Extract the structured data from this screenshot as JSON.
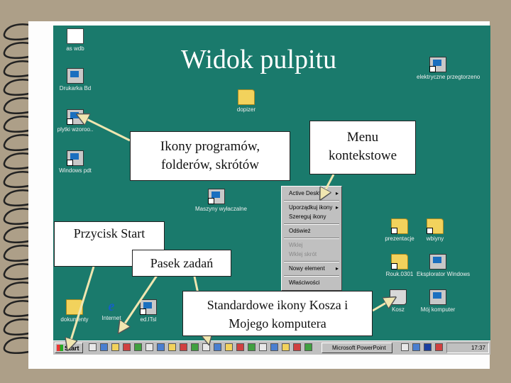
{
  "slide": {
    "title": "Widok pulpitu",
    "callouts": {
      "icons": [
        "Ikony programów,",
        "folderów, skrótów"
      ],
      "menu": [
        "Menu",
        "kontekstowe"
      ],
      "start": "Przycisk Start",
      "taskbar": "Pasek zadań",
      "standard": [
        "Standardowe ikony Kosza i",
        "Mojego komputera"
      ]
    }
  },
  "desktop": {
    "icons_left": [
      {
        "label": "as wdb",
        "icon": "doc-icon"
      },
      {
        "label": "Drukarka Bd",
        "icon": "printer-icon"
      },
      {
        "label": "plytki wzoroo..",
        "icon": "program-icon"
      },
      {
        "label": "Windows pdt",
        "icon": "program-icon"
      }
    ],
    "icons_bottom_left": [
      {
        "label": "dokumenty",
        "icon": "folder-icon"
      },
      {
        "label": "Internet",
        "icon": "ie-icon"
      },
      {
        "label": "ed.ITsl",
        "icon": "program-icon"
      }
    ],
    "icons_center": [
      {
        "label": "dopizer",
        "icon": "folder-icon"
      },
      {
        "label": "Maszyny wyłaczalne",
        "icon": "program-icon"
      }
    ],
    "icons_right": [
      {
        "label": "elektryczne przegtorzeno",
        "icon": "program-icon"
      },
      {
        "label": "prezentacje",
        "icon": "folder-icon"
      },
      {
        "label": "wbiyny",
        "icon": "folder-icon"
      },
      {
        "label": "Rouk.0301",
        "icon": "folder-icon"
      },
      {
        "label": "Eksplorator Windows",
        "icon": "explorer-icon"
      },
      {
        "label": "Kosz",
        "icon": "recycle-bin-icon"
      },
      {
        "label": "Mój komputer",
        "icon": "computer-icon"
      }
    ]
  },
  "context_menu": {
    "items": [
      {
        "label": "Active Desktop",
        "arrow": "▸",
        "disabled": false
      },
      {
        "label": "Uporządkuj ikony",
        "arrow": "▸",
        "disabled": false
      },
      {
        "label": "Szereguj ikony",
        "arrow": "",
        "disabled": false
      },
      {
        "label": "Odśwież",
        "arrow": "",
        "disabled": false
      },
      {
        "label": "Wklej",
        "arrow": "",
        "disabled": true
      },
      {
        "label": "Wklej skrót",
        "arrow": "",
        "disabled": true
      },
      {
        "label": "Nowy element",
        "arrow": "▸",
        "disabled": false
      },
      {
        "label": "Właściwości",
        "arrow": "",
        "disabled": false
      }
    ]
  },
  "taskbar": {
    "start_label": "Start",
    "task": "Microsoft PowerPoint",
    "clock": "17:37"
  },
  "colors": {
    "desktop": "#1a7a6c",
    "arrow": "#f0e6b0"
  }
}
